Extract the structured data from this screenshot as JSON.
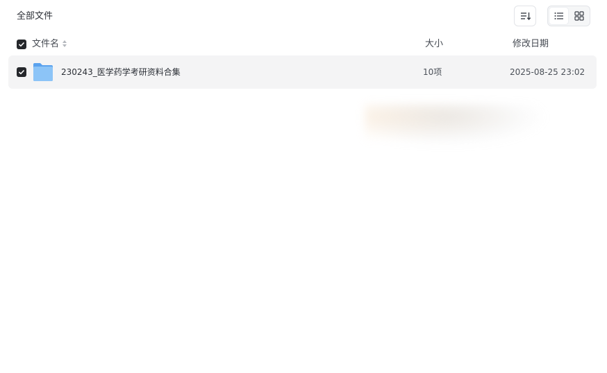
{
  "header": {
    "title": "全部文件"
  },
  "toolbar": {
    "sort_icon": "sort-icon",
    "view_list_icon": "list-view-icon",
    "view_grid_icon": "grid-view-icon",
    "active_view": "list"
  },
  "columns": {
    "name": "文件名",
    "size": "大小",
    "modified": "修改日期"
  },
  "files": [
    {
      "name": "230243_医学药学考研资料合集",
      "size": "10项",
      "modified": "2025-08-25 23:02",
      "type": "folder",
      "checked": true
    }
  ],
  "colors": {
    "checkbox": "#25272b",
    "row_hover": "#f4f4f5",
    "folder": "#7ab8f5"
  }
}
